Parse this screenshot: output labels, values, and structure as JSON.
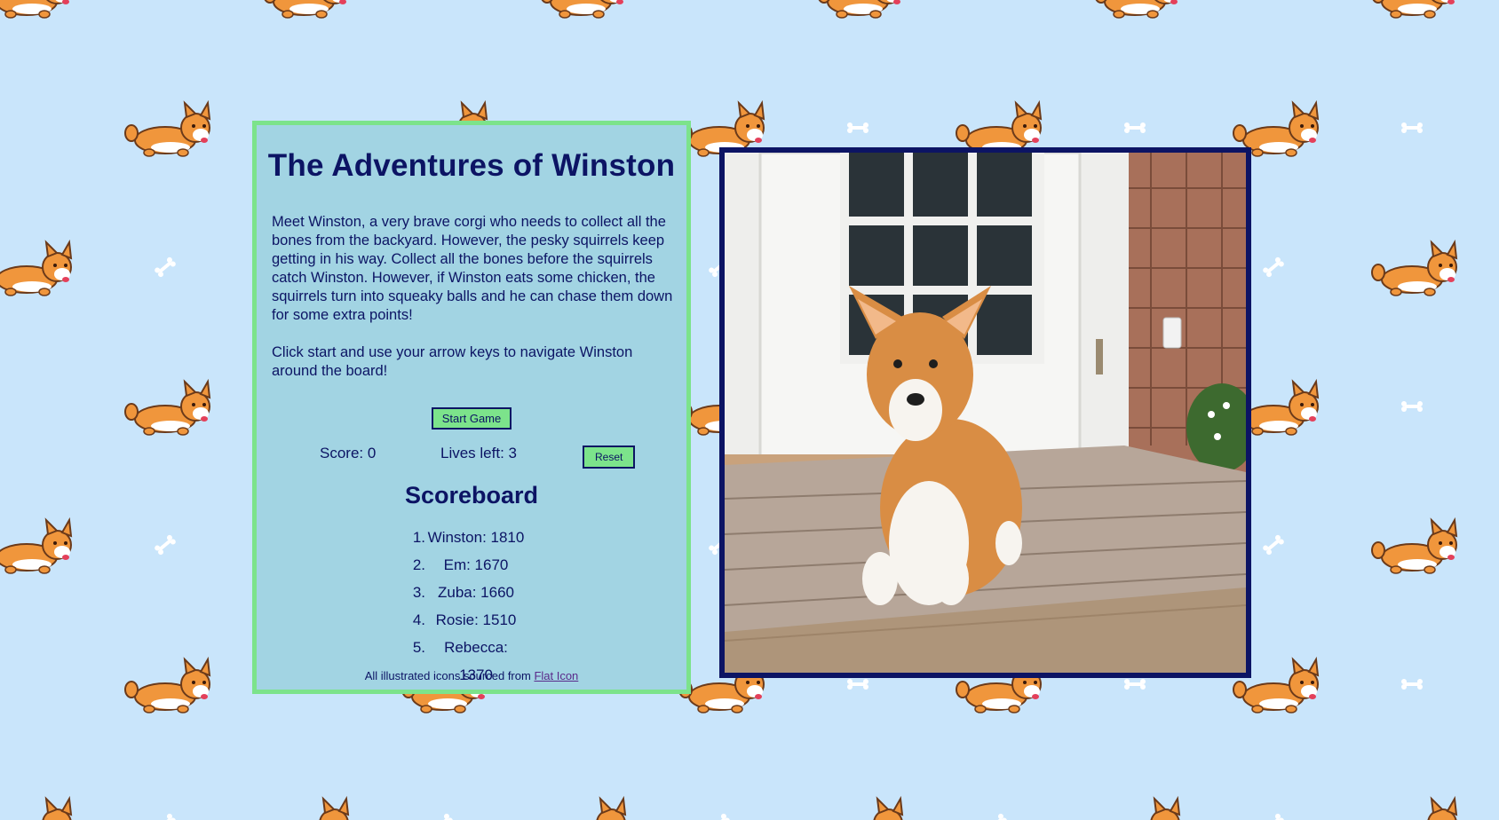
{
  "title": "The Adventures of Winston",
  "intro": {
    "paragraph1": "Meet Winston, a very brave corgi who needs to collect all the bones from the backyard. However, the pesky squirrels keep getting in his way. Collect all the bones before the squirrels catch Winston. However, if Winston eats some chicken, the squirrels turn into squeaky balls and he can chase them down for some extra points!",
    "paragraph2": "Click start and use your arrow keys to navigate Winston around the board!"
  },
  "controls": {
    "start_label": "Start Game",
    "score_text": "Score: 0",
    "lives_text": "Lives left: 3",
    "reset_label": "Reset"
  },
  "scoreboard": {
    "title": "Scoreboard",
    "entries": [
      {
        "rank": "1.",
        "text": "Winston: 1810"
      },
      {
        "rank": "2.",
        "text": "Em: 1670"
      },
      {
        "rank": "3.",
        "text": "Zuba: 1660"
      },
      {
        "rank": "4.",
        "text": "Rosie: 1510"
      },
      {
        "rank": "5.",
        "text": "Rebecca: 1370"
      }
    ]
  },
  "credits": {
    "prefix": "All illustrated icons sourced from ",
    "link_text": "Flat Icon"
  },
  "photo": {
    "subject": "corgi-photo"
  },
  "colors": {
    "page_background": "#c9e5fb",
    "panel_background": "#a2d4e3",
    "panel_border": "#7ce38b",
    "text": "#0c1464",
    "button": "#7ce38b",
    "photo_border": "#0c1464",
    "corgi_orange": "#f0963c",
    "bone": "#ffffff"
  },
  "icons": {
    "background_pattern": [
      "corgi-icon",
      "bone-icon"
    ]
  }
}
